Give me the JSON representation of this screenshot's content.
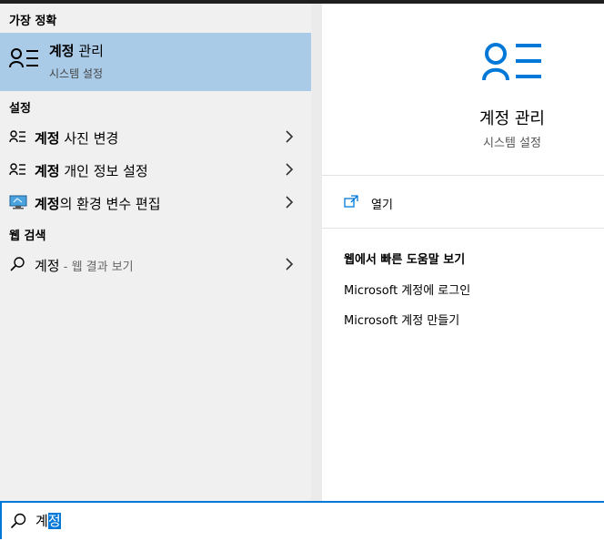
{
  "left": {
    "best_match_header": "가장 정확",
    "best_match": {
      "title_bold": "계정",
      "title_rest": " 관리",
      "subtitle": "시스템 설정",
      "icon": "person-list-icon"
    },
    "settings_header": "설정",
    "settings_items": [
      {
        "bold": "계정",
        "rest": " 사진 변경",
        "icon": "person-list-icon"
      },
      {
        "bold": "계정",
        "rest": " 개인 정보 설정",
        "icon": "person-list-icon"
      },
      {
        "bold": "계정",
        "rest": "의 환경 변수 편집",
        "icon": "monitor-icon"
      }
    ],
    "web_header": "웹 검색",
    "web_item": {
      "text": "계정",
      "suffix": " - 웹 결과 보기",
      "icon": "search-icon"
    }
  },
  "right": {
    "title": "계정 관리",
    "subtitle": "시스템 설정",
    "open_label": "열기",
    "web_heading": "웹에서 빠른 도움말 보기",
    "links": [
      "Microsoft 계정에 로그인",
      "Microsoft 계정 만들기"
    ]
  },
  "search": {
    "text_plain": "계",
    "text_selected": "정"
  },
  "colors": {
    "accent": "#0078d7",
    "highlight": "#a9cbe8",
    "panel": "#f0f0f0"
  }
}
